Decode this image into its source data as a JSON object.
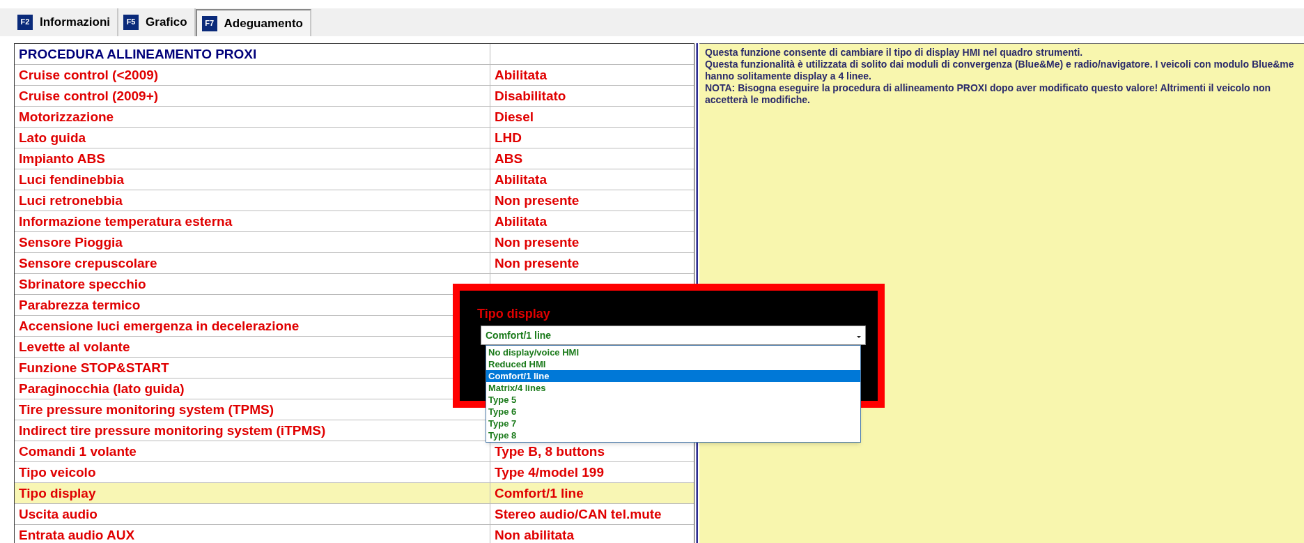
{
  "tabs": [
    {
      "key": "F2",
      "label": "Informazioni",
      "selected": false
    },
    {
      "key": "F5",
      "label": "Grafico",
      "selected": false
    },
    {
      "key": "F7",
      "label": "Adeguamento",
      "selected": true
    }
  ],
  "table": {
    "title": "PROCEDURA ALLINEAMENTO PROXI",
    "rows": [
      {
        "name": "Cruise control (<2009)",
        "value": "Abilitata",
        "selected": false
      },
      {
        "name": "Cruise control (2009+)",
        "value": "Disabilitato",
        "selected": false
      },
      {
        "name": "Motorizzazione",
        "value": "Diesel",
        "selected": false
      },
      {
        "name": "Lato guida",
        "value": "LHD",
        "selected": false
      },
      {
        "name": "Impianto ABS",
        "value": "ABS",
        "selected": false
      },
      {
        "name": "Luci fendinebbia",
        "value": "Abilitata",
        "selected": false
      },
      {
        "name": "Luci retronebbia",
        "value": "Non presente",
        "selected": false
      },
      {
        "name": "Informazione temperatura esterna",
        "value": "Abilitata",
        "selected": false
      },
      {
        "name": "Sensore Pioggia",
        "value": "Non presente",
        "selected": false
      },
      {
        "name": "Sensore crepuscolare",
        "value": "Non presente",
        "selected": false
      },
      {
        "name": "Sbrinatore specchio",
        "selected": false
      },
      {
        "name": "Parabrezza termico",
        "selected": false
      },
      {
        "name": "Accensione luci emergenza in decelerazione",
        "selected": false
      },
      {
        "name": "Levette al volante",
        "selected": false
      },
      {
        "name": "Funzione STOP&START",
        "selected": false
      },
      {
        "name": "Paraginocchia (lato guida)",
        "selected": false
      },
      {
        "name": "Tire pressure monitoring system (TPMS)",
        "selected": false
      },
      {
        "name": "Indirect tire pressure monitoring system (iTPMS)",
        "selected": false
      },
      {
        "name": "Comandi 1 volante",
        "value": "Type B, 8 buttons",
        "selected": false
      },
      {
        "name": "Tipo veicolo",
        "value": "Type 4/model 199",
        "selected": false
      },
      {
        "name": "Tipo display",
        "value": "Comfort/1 line",
        "selected": true
      },
      {
        "name": "Uscita audio",
        "value": "Stereo audio/CAN tel.mute",
        "selected": false
      },
      {
        "name": "Entrata audio AUX",
        "value": "Non abilitata",
        "selected": false
      }
    ]
  },
  "help": [
    "Questa funzione consente di cambiare il tipo di display HMI nel quadro strumenti.",
    "Questa funzionalità è utilizzata di solito dai moduli di convergenza (Blue&Me) e radio/navigatore. I veicoli con modulo Blue&me hanno solitamente display a 4 linee.",
    "NOTA: Bisogna eseguire la procedura di allineamento PROXI dopo aver modificato questo valore! Altrimenti il veicolo non accetterà le modifiche."
  ],
  "dialog": {
    "title": "Tipo display",
    "select": {
      "value": "Comfort/1 line",
      "expanded": true,
      "options": [
        {
          "label": "No display/voice HMI",
          "selected": false
        },
        {
          "label": "Reduced HMI",
          "selected": false
        },
        {
          "label": "Comfort/1 line",
          "selected": true
        },
        {
          "label": "Matrix/4 lines",
          "selected": false
        },
        {
          "label": "Type 5",
          "selected": false
        },
        {
          "label": "Type 6",
          "selected": false
        },
        {
          "label": "Type 7",
          "selected": false
        },
        {
          "label": "Type 8",
          "selected": false
        }
      ]
    }
  }
}
